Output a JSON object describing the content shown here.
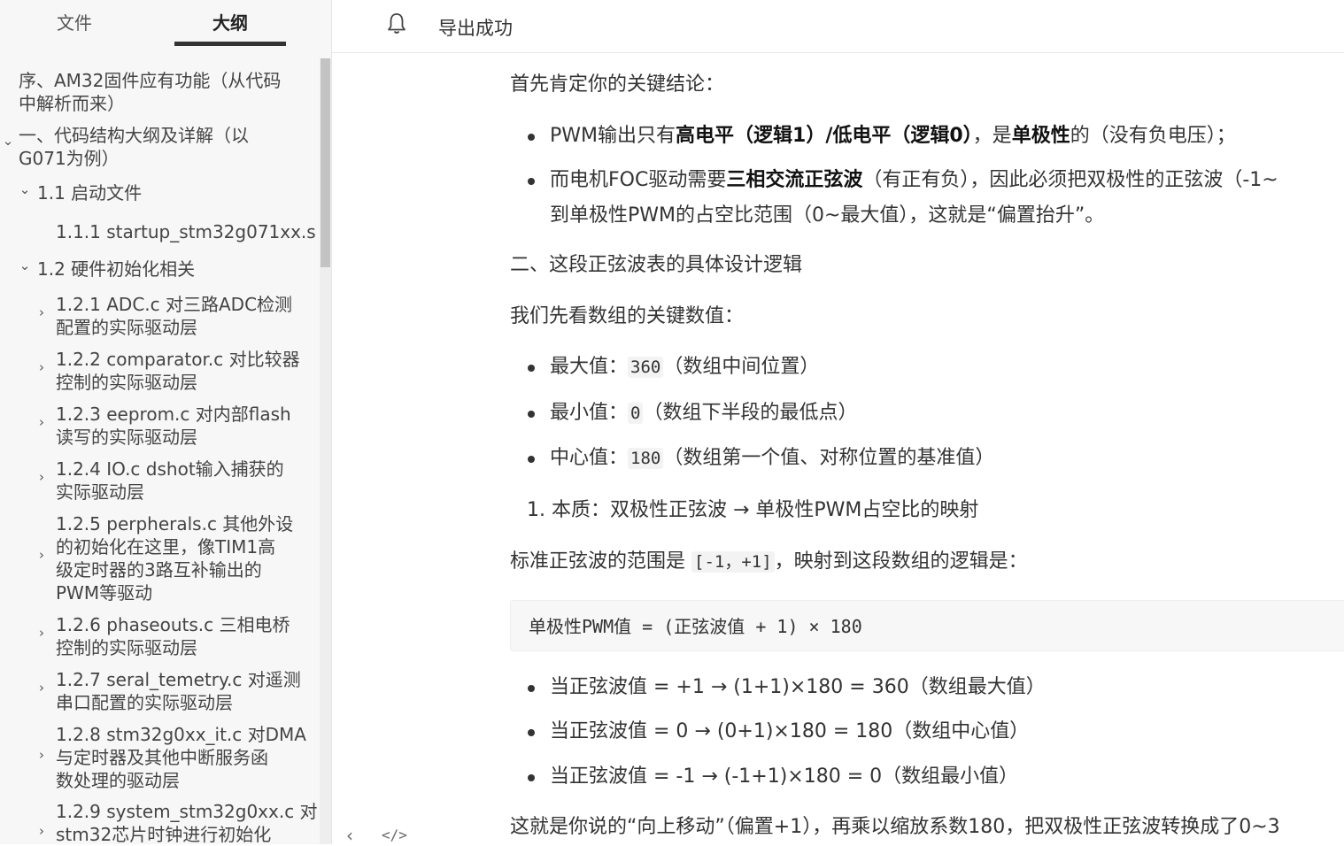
{
  "sidebar": {
    "tabs": {
      "files": "文件",
      "outline": "大纲"
    },
    "items": [
      {
        "l1": "序、AM32固件应有功能（从代码",
        "l2": "中解析而来）",
        "chev": ""
      },
      {
        "l1": "一、代码结构大纲及详解（以",
        "l2": "G071为例）",
        "chev": "⌄"
      },
      {
        "l1": "1.1 启动文件",
        "chev": "⌄"
      },
      {
        "l1": "1.1.1 startup_stm32g071xx.s",
        "chev": ""
      },
      {
        "l1": "1.2 硬件初始化相关",
        "chev": "⌄"
      },
      {
        "l1": "1.2.1 ADC.c 对三路ADC检测",
        "l2": "配置的实际驱动层",
        "chev": "›"
      },
      {
        "l1": "1.2.2 comparator.c 对比较器",
        "l2": "控制的实际驱动层",
        "chev": "›"
      },
      {
        "l1": "1.2.3 eeprom.c 对内部flash",
        "l2": "读写的实际驱动层",
        "chev": "›"
      },
      {
        "l1": "1.2.4 IO.c dshot输入捕获的",
        "l2": "实际驱动层",
        "chev": "›"
      },
      {
        "l1": "1.2.5 perpherals.c 其他外设",
        "l2": "的初始化在这里，像TIM1高",
        "l3": "级定时器的3路互补输出的",
        "l4": "PWM等驱动",
        "chev": "›"
      },
      {
        "l1": "1.2.6 phaseouts.c 三相电桥",
        "l2": "控制的实际驱动层",
        "chev": "›"
      },
      {
        "l1": "1.2.7 seral_temetry.c 对遥测",
        "l2": "串口配置的实际驱动层",
        "chev": "›"
      },
      {
        "l1": "1.2.8 stm32g0xx_it.c 对DMA",
        "l2": "与定时器及其他中断服务函",
        "l3": "数处理的驱动层",
        "chev": "›"
      },
      {
        "l1": "1.2.9 system_stm32g0xx.c 对",
        "l2": "stm32芯片时钟进行初始化",
        "chev": "›"
      }
    ]
  },
  "topbar": {
    "toast": "导出成功"
  },
  "content": {
    "p1": "首先肯定你的关键结论：",
    "b1": {
      "a": "PWM输出只有",
      "b": "高电平（逻辑1）/低电平（逻辑0）",
      "c": "，是",
      "d": "单极性",
      "e": "的（没有负电压）；"
    },
    "b2": {
      "a": "而电机FOC驱动需要",
      "b": "三相交流正弦波",
      "c": "（有正有负），因此必须把双极性的正弦波（-1~",
      "line2": "到单极性PWM的占空比范围（0~最大值），这就是“偏置抬升”。"
    },
    "h2": "二、这段正弦波表的具体设计逻辑",
    "p2": "我们先看数组的关键数值：",
    "b3": {
      "a": "最大值：",
      "code": "360",
      "c": "（数组中间位置）"
    },
    "b4": {
      "a": "最小值：",
      "code": "0",
      "c": "（数组下半段的最低点）"
    },
    "b5": {
      "a": "中心值：",
      "code": "180",
      "c": "（数组第一个值、对称位置的基准值）"
    },
    "ol1": "1. 本质：双极性正弦波 → 单极性PWM占空比的映射",
    "p3": {
      "a": "标准正弦波的范围是 ",
      "code": "[-1，+1]",
      "c": "，映射到这段数组的逻辑是："
    },
    "code": "单极性PWM值 = (正弦波值 + 1) × 180",
    "b6": "当正弦波值 = +1 → (1+1)×180 = 360（数组最大值）",
    "b7": "当正弦波值 = 0 → (0+1)×180 = 180（数组中心值）",
    "b8": "当正弦波值 = -1 → (-1+1)×180 = 0（数组最小值）",
    "p4": "这就是你说的“向上移动”（偏置+1），再乘以缩放系数180，把双极性正弦波转换成了0~3"
  },
  "icons": {
    "bell": "bell-icon",
    "collapse": "chevron-left-icon",
    "source": "code-icon"
  }
}
